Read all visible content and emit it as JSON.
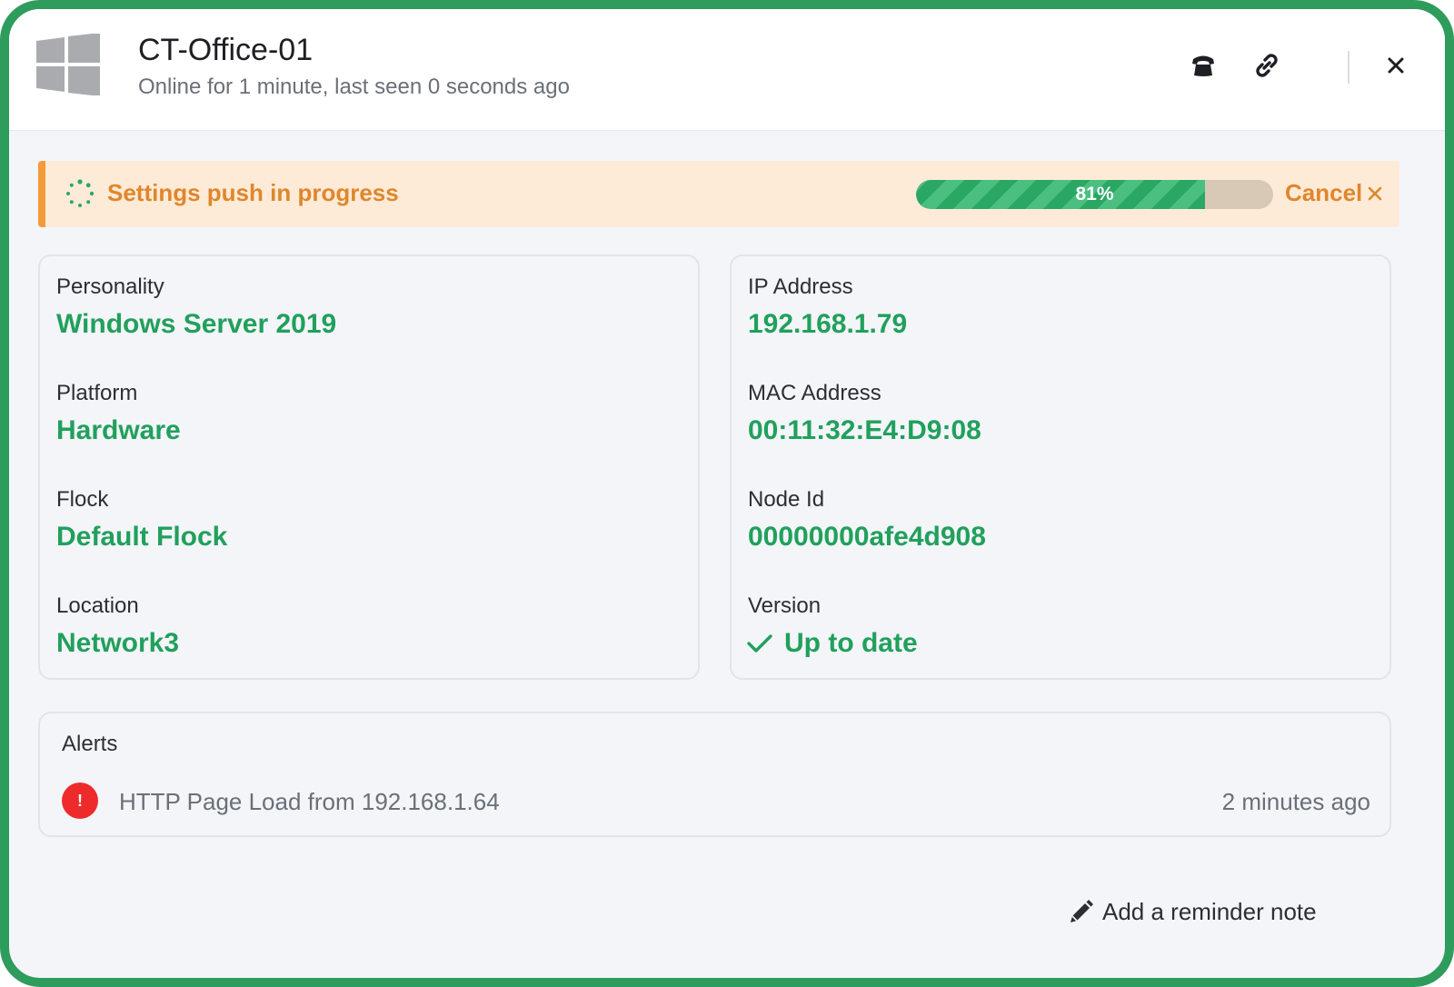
{
  "header": {
    "title": "CT-Office-01",
    "subtitle": "Online for 1 minute, last seen 0 seconds ago",
    "os_icon": "windows-logo-icon",
    "actions": {
      "phone_icon": "phone-icon",
      "link_icon": "link-icon",
      "close_icon": "close-icon"
    }
  },
  "banner": {
    "message": "Settings push in progress",
    "progress_percent": 81,
    "progress_label": "81%",
    "cancel_label": "Cancel",
    "cancel_icon": "close-icon"
  },
  "details_left": [
    {
      "label": "Personality",
      "value": "Windows Server 2019"
    },
    {
      "label": "Platform",
      "value": "Hardware"
    },
    {
      "label": "Flock",
      "value": "Default Flock"
    },
    {
      "label": "Location",
      "value": "Network3"
    }
  ],
  "details_right": [
    {
      "label": "IP Address",
      "value": "192.168.1.79"
    },
    {
      "label": "MAC Address",
      "value": "00:11:32:E4:D9:08"
    },
    {
      "label": "Node Id",
      "value": "00000000afe4d908"
    },
    {
      "label": "Version",
      "value": "Up to date",
      "icon": "checkmark-icon"
    }
  ],
  "alerts": {
    "title": "Alerts",
    "items": [
      {
        "text": "HTTP Page Load from 192.168.1.64",
        "time": "2 minutes ago",
        "icon": "alert-icon",
        "badge": "!"
      }
    ]
  },
  "footer": {
    "reminder_label": "Add a reminder note",
    "reminder_icon": "pencil-icon"
  },
  "colors": {
    "frame": "#2e9c5c",
    "accent_green": "#21a05c",
    "banner_bg": "#fdebd7",
    "banner_accent": "#f39a3a",
    "banner_text": "#e0862c",
    "alert_red": "#ee2b2b"
  }
}
